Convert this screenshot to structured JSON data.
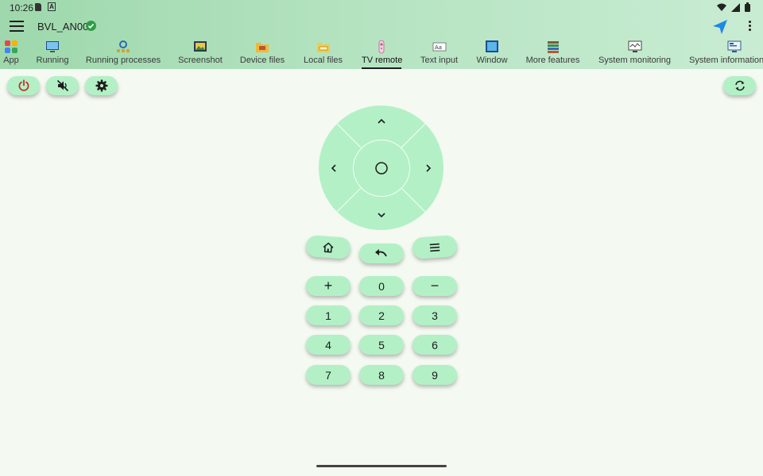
{
  "status_bar": {
    "time": "10:26"
  },
  "app_bar": {
    "device_name": "BVL_AN00"
  },
  "tabs": [
    {
      "label": "App",
      "icon": "app-grid-icon"
    },
    {
      "label": "Running",
      "icon": "monitor-icon"
    },
    {
      "label": "Running processes",
      "icon": "processes-gear-icon"
    },
    {
      "label": "Screenshot",
      "icon": "screenshot-icon"
    },
    {
      "label": "Device files",
      "icon": "folder-icon"
    },
    {
      "label": "Local files",
      "icon": "local-folder-icon"
    },
    {
      "label": "TV remote",
      "icon": "remote-icon"
    },
    {
      "label": "Text input",
      "icon": "text-input-icon"
    },
    {
      "label": "Window",
      "icon": "window-icon"
    },
    {
      "label": "More features",
      "icon": "stack-icon"
    },
    {
      "label": "System monitoring",
      "icon": "system-monitor-icon"
    },
    {
      "label": "System information",
      "icon": "system-info-icon"
    }
  ],
  "active_tab": "TV remote",
  "colors": {
    "accent_green": "#b3f0c6",
    "header_green": "#9ed8ac",
    "power_red": "#c62828",
    "send_blue": "#1e88e5",
    "verified_green": "#2e9e46"
  },
  "keypad": {
    "plus": "+",
    "minus": "−",
    "digits": [
      "0",
      "1",
      "2",
      "3",
      "4",
      "5",
      "6",
      "7",
      "8",
      "9"
    ]
  }
}
